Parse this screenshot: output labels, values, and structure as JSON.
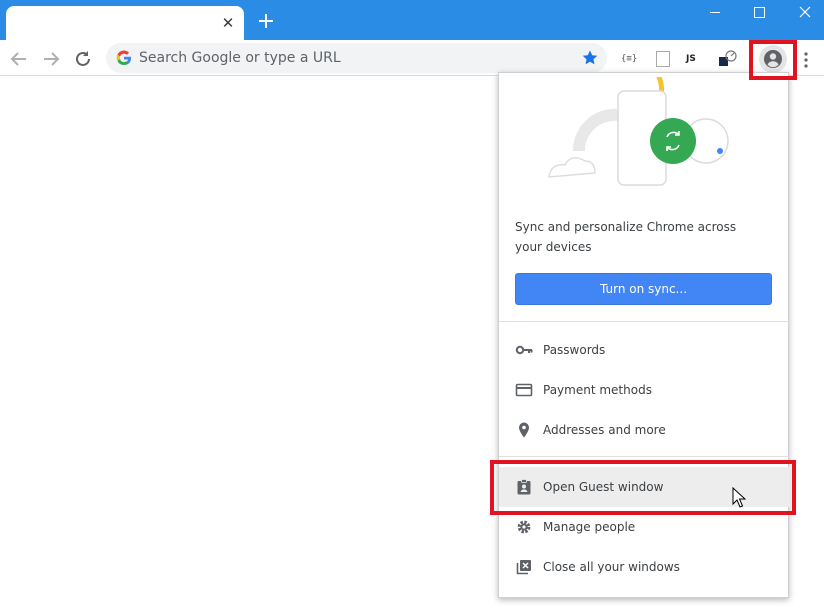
{
  "browser": {
    "tab_close_glyph": "✕",
    "new_tab_icon": "plus-icon",
    "window_controls": [
      "minimize",
      "maximize",
      "close"
    ],
    "accent_color": "#2b8ce6"
  },
  "omnibox": {
    "placeholder": "Search Google or type a URL",
    "value": ""
  },
  "extensions": {
    "json_label": "{≡}",
    "js_label": "JS"
  },
  "profile_menu": {
    "sync_description": "Sync and personalize Chrome across your devices",
    "sync_button": "Turn on sync...",
    "items": [
      {
        "label": "Passwords",
        "icon": "key-icon"
      },
      {
        "label": "Payment methods",
        "icon": "credit-card-icon"
      },
      {
        "label": "Addresses and more",
        "icon": "location-pin-icon"
      },
      {
        "label": "Open Guest window",
        "icon": "guest-badge-icon"
      },
      {
        "label": "Manage people",
        "icon": "gear-icon"
      },
      {
        "label": "Close all your windows",
        "icon": "close-windows-icon"
      }
    ],
    "highlight_color": "#e0141e",
    "button_color": "#4285f4"
  }
}
